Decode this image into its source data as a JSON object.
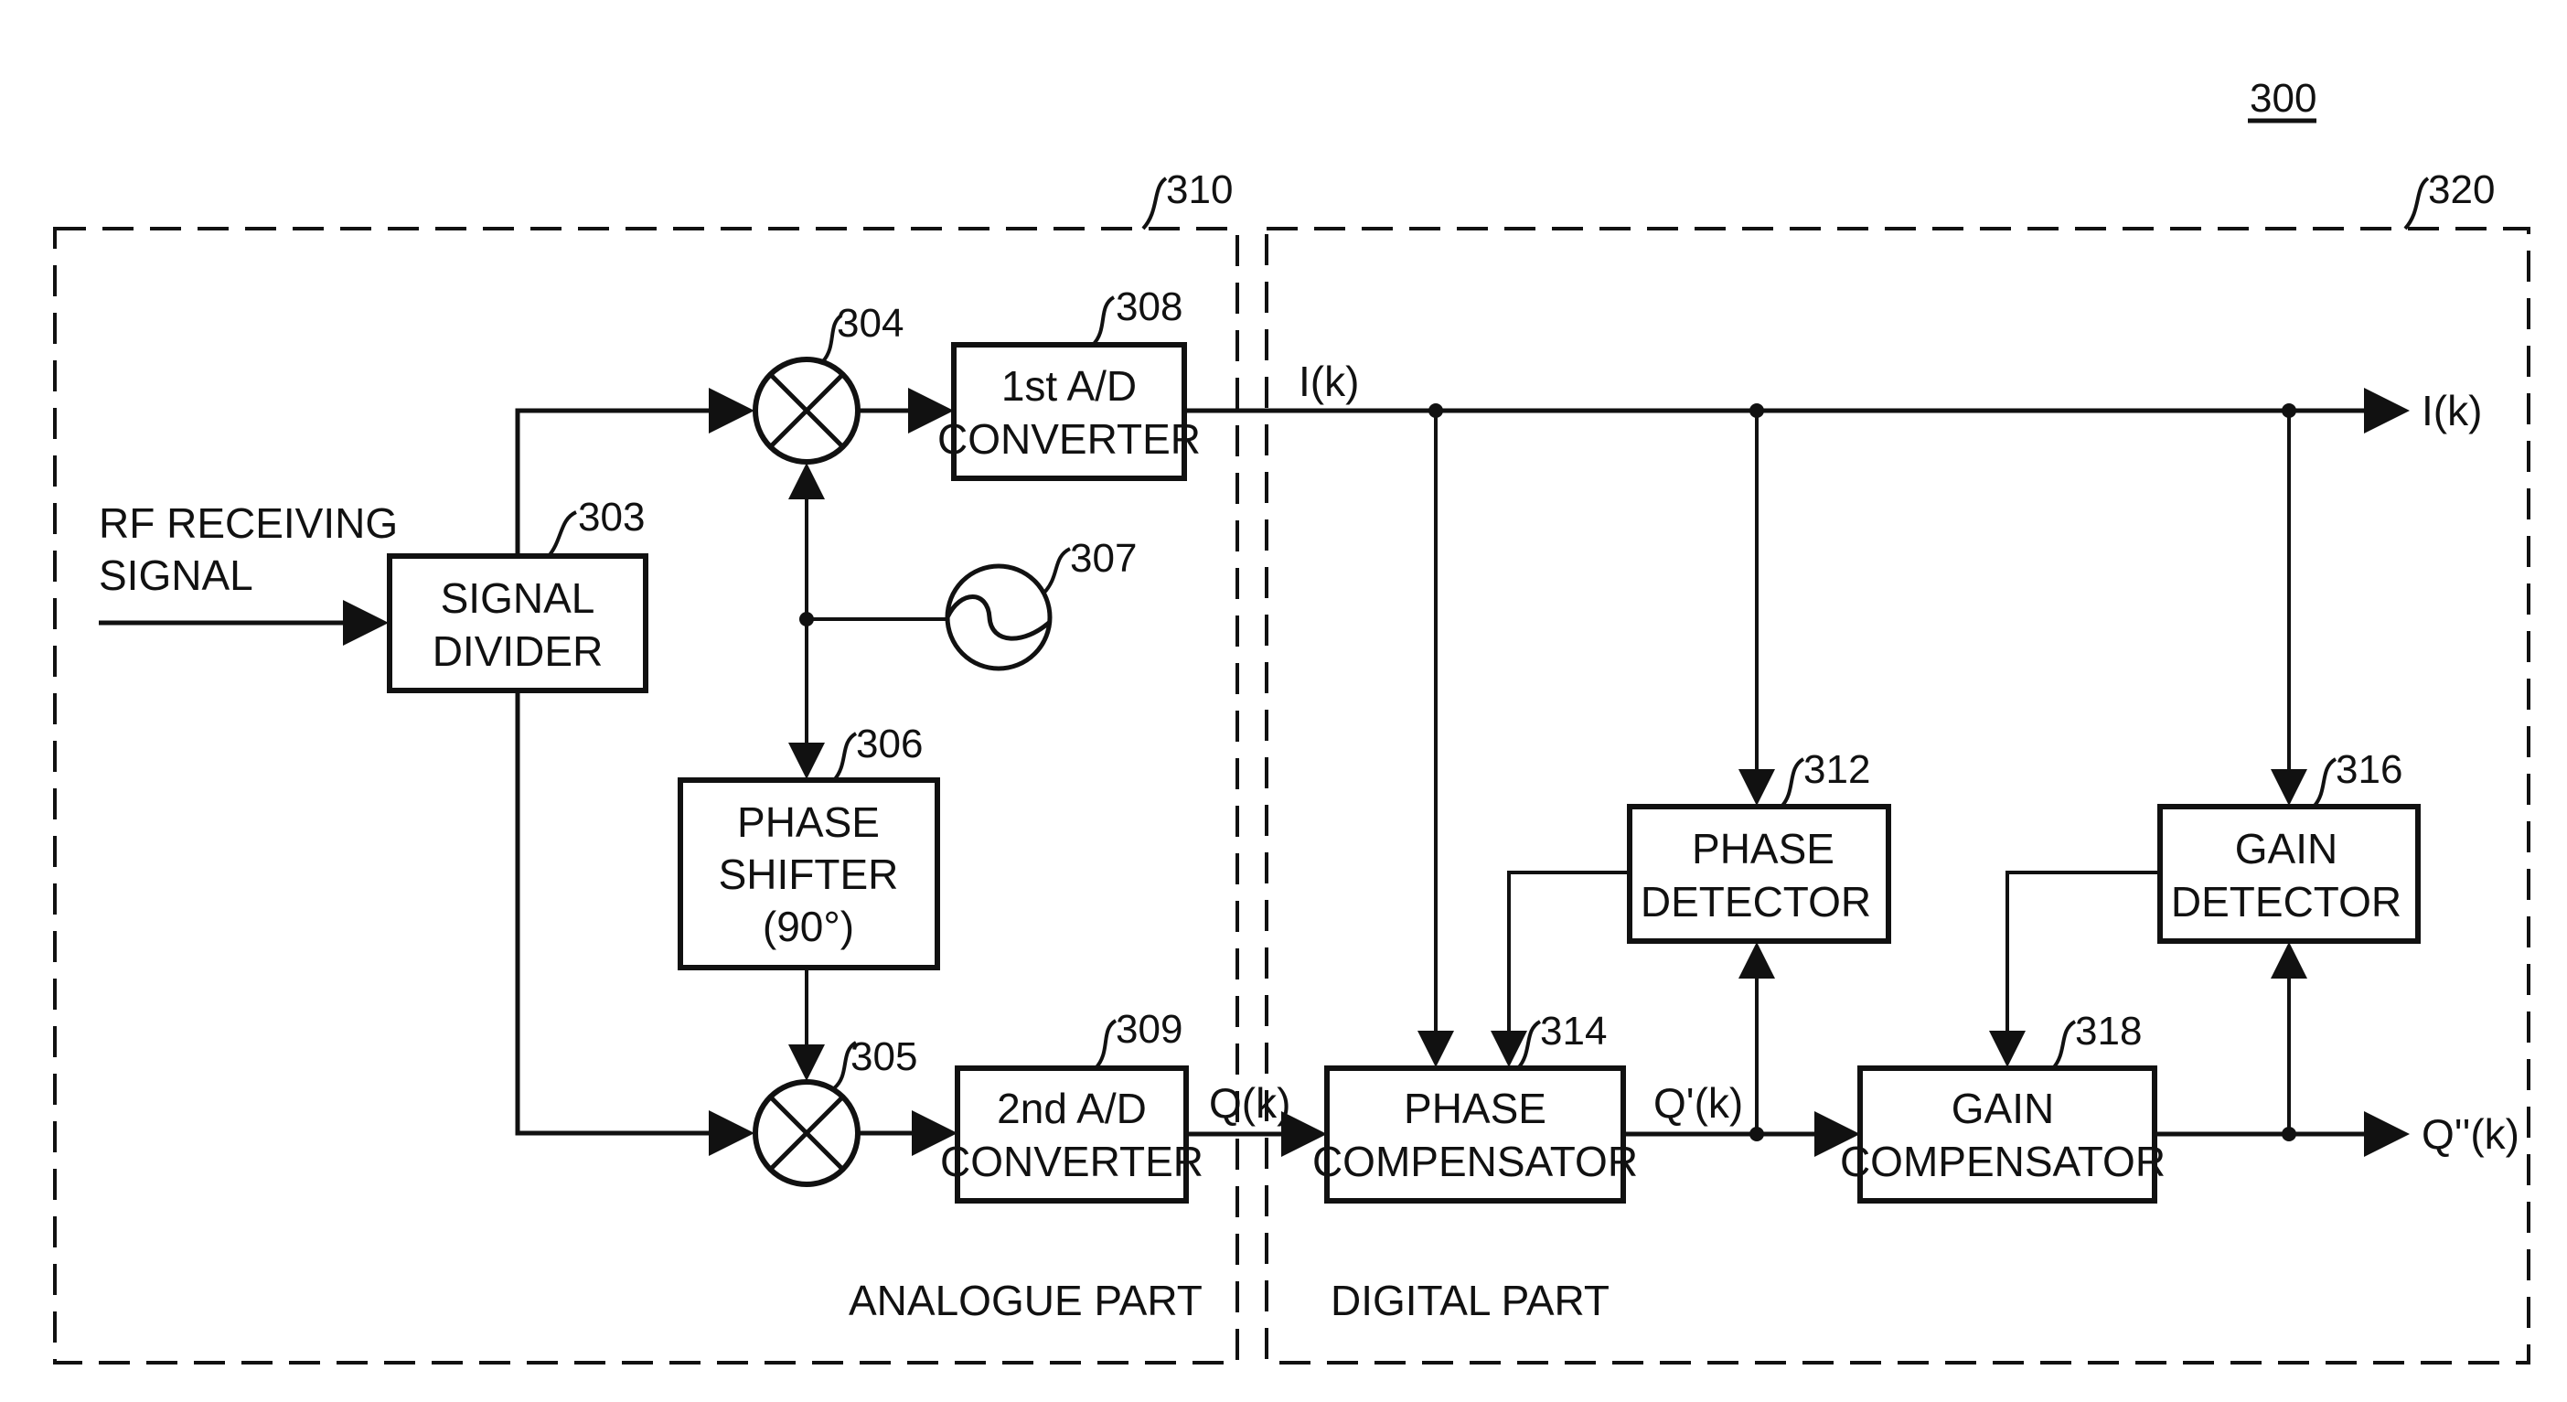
{
  "figure": {
    "number": "300",
    "regions": [
      {
        "ref": "310",
        "label": "ANALOGUE PART"
      },
      {
        "ref": "320",
        "label": "DIGITAL PART"
      }
    ],
    "input_label": [
      "RF RECEIVING",
      "SIGNAL"
    ],
    "blocks": {
      "signal_divider": {
        "ref": "303",
        "lines": [
          "SIGNAL",
          "DIVIDER"
        ]
      },
      "mixer_i": {
        "ref": "304"
      },
      "mixer_q": {
        "ref": "305"
      },
      "phase_shifter": {
        "ref": "306",
        "lines": [
          "PHASE",
          "SHIFTER",
          "(90°)"
        ]
      },
      "oscillator": {
        "ref": "307"
      },
      "adc1": {
        "ref": "308",
        "lines": [
          "1st A/D",
          "CONVERTER"
        ]
      },
      "adc2": {
        "ref": "309",
        "lines": [
          "2nd A/D",
          "CONVERTER"
        ]
      },
      "phase_detector": {
        "ref": "312",
        "lines": [
          "PHASE",
          "DETECTOR"
        ]
      },
      "phase_compensator": {
        "ref": "314",
        "lines": [
          "PHASE",
          "COMPENSATOR"
        ]
      },
      "gain_detector": {
        "ref": "316",
        "lines": [
          "GAIN",
          "DETECTOR"
        ]
      },
      "gain_compensator": {
        "ref": "318",
        "lines": [
          "GAIN",
          "COMPENSATOR"
        ]
      }
    },
    "signals": {
      "i_in": "I(k)",
      "i_out": "I(k)",
      "q_in": "Q(k)",
      "q_prime": "Q'(k)",
      "q_out": "Q''(k)"
    }
  }
}
